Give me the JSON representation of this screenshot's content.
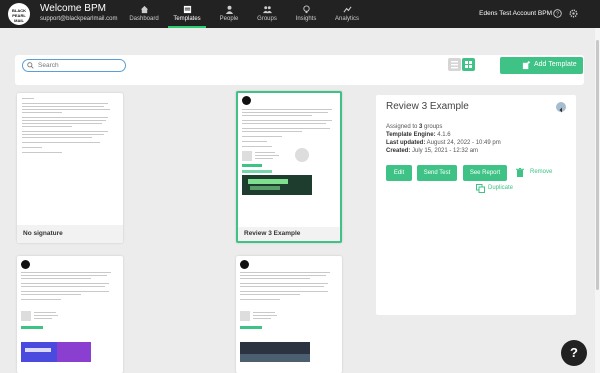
{
  "header": {
    "logo_text": "BLACK PEARL MAIL",
    "title": "Welcome BPM",
    "email": "support@blackpearlmail.com",
    "nav": [
      {
        "label": "Dashboard",
        "icon": "home-icon"
      },
      {
        "label": "Templates",
        "icon": "templates-icon",
        "active": true
      },
      {
        "label": "People",
        "icon": "person-icon"
      },
      {
        "label": "Groups",
        "icon": "groups-icon"
      },
      {
        "label": "Insights",
        "icon": "lightbulb-icon"
      },
      {
        "label": "Analytics",
        "icon": "analytics-icon"
      }
    ],
    "account": "Edens Test Account BPM",
    "help_icon": "help-circle-icon",
    "settings_icon": "gear-icon"
  },
  "toolbar": {
    "search_placeholder": "Search",
    "add_label": "Add Template"
  },
  "cards": [
    {
      "label": "No signature"
    },
    {
      "label": "Review 3 Example",
      "selected": true
    },
    {
      "label": ""
    },
    {
      "label": ""
    }
  ],
  "detail": {
    "title": "Review 3 Example",
    "assigned_prefix": "Assigned to ",
    "assigned_count": "3",
    "assigned_suffix": " groups",
    "engine_label": "Template Engine:",
    "engine_value": " 4.1.6",
    "updated_label": "Last updated:",
    "updated_value": " August 24, 2022 - 10:49 pm",
    "created_label": "Created:",
    "created_value": " July 15, 2021 - 12:32 am",
    "buttons": {
      "edit": "Edit",
      "send": "Send Test",
      "report": "See Report"
    },
    "remove": "Remove",
    "duplicate": "Duplicate"
  },
  "help_button": "?",
  "colors": {
    "accent": "#3ec286",
    "topbar": "#222222",
    "background": "#ececec"
  }
}
